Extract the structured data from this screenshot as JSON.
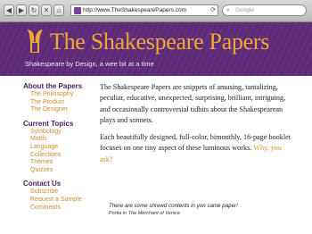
{
  "browser": {
    "nav_icons": [
      "back-icon",
      "forward-icon",
      "reload-icon",
      "stop-icon",
      "home-icon"
    ],
    "url": "http://www.TheShakespearePapers.com",
    "search_placeholder": "Google"
  },
  "header": {
    "title": "The Shakespeare Papers",
    "tagline": "Shakespeare by Design, a wee bit at a time",
    "colors": {
      "banner": "#5e2a7a",
      "title": "#f0a92e"
    }
  },
  "sidebar": {
    "sections": [
      {
        "title": "About the Papers",
        "items": [
          "The Philosophy",
          "The Product",
          "The Designer"
        ]
      },
      {
        "title": "Current Topics",
        "items": [
          "Symbology",
          "Motifs",
          "Language",
          "Collections",
          "Themes",
          "Quizzes"
        ]
      },
      {
        "title": "Contact Us",
        "items": [
          "Subscribe",
          "Request a Sample",
          "Comments"
        ]
      }
    ]
  },
  "main": {
    "para1": "The Shakespeare Papers are snippets of amusing, tantalizing, peculiar, educative, unexpected, surprising, brilliant, intriguing, and occasionally controversial tidbits about the Shakespearean plays and sonnets.",
    "para2": "Each beautifully designed, full-color, bimonthly, 16-page booklet focuses on one tiny aspect of these luminous works.",
    "para2_link": "Why, you ask?",
    "quote": "There are some shrewd contents in yon same paper!",
    "attribution_speaker": "Portia in",
    "attribution_work": "The Merchant of Venice"
  }
}
